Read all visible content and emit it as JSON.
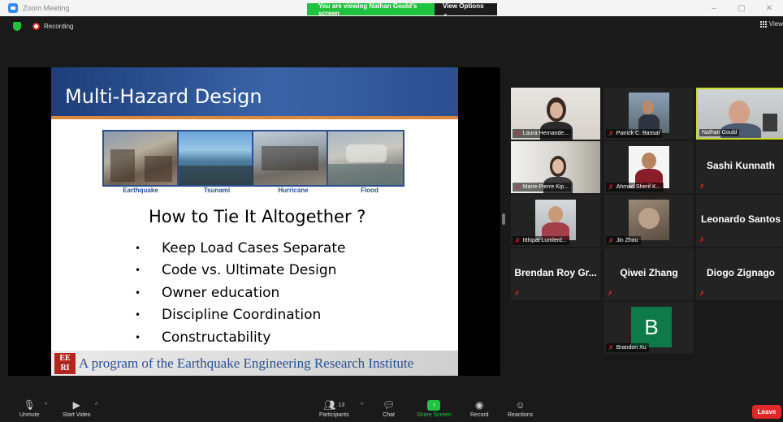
{
  "window": {
    "title": "Zoom Meeting",
    "viewing_banner": "You are viewing Nathan Gould's screen",
    "view_options": "View Options ⌄",
    "controls": [
      "–",
      "▢",
      "✕"
    ]
  },
  "status": {
    "recording_label": "Recording",
    "view_label": "View"
  },
  "slide": {
    "title": "Multi-Hazard Design",
    "photo_labels": [
      "Earthquake",
      "Tsunami",
      "Hurricane",
      "Flood"
    ],
    "subtitle": "How to Tie It Altogether ?",
    "bullets": [
      "Keep Load Cases Separate",
      "Code vs. Ultimate Design",
      "Owner education",
      "Discipline Coordination",
      "Constructability"
    ],
    "logo_lines": [
      "EE",
      "RI"
    ],
    "footer": "A program of the Earthquake Engineering Research Institute"
  },
  "participants": [
    {
      "name": "Laura Hernande...",
      "muted": true,
      "video": true
    },
    {
      "name": "Patrick C. Bassal",
      "muted": true,
      "video": true
    },
    {
      "name": "Nathan Gould",
      "muted": false,
      "video": true,
      "active": true
    },
    {
      "name": "Marie-Pierre Kip...",
      "muted": true,
      "video": true
    },
    {
      "name": "Ahmad Sherif K...",
      "muted": true,
      "video": true
    },
    {
      "name": "Sashi Kunnath",
      "muted": true,
      "video": false
    },
    {
      "name": "Itthipat Lumlerd...",
      "muted": true,
      "video": true
    },
    {
      "name": "Jin Zhou",
      "muted": true,
      "video": true
    },
    {
      "name": "Leonardo Santos",
      "muted": true,
      "video": false
    },
    {
      "name": "Brendan Roy Gr...",
      "muted": true,
      "video": false
    },
    {
      "name": "Qiwei Zhang",
      "muted": true,
      "video": false
    },
    {
      "name": "Diogo Zignago",
      "muted": true,
      "video": false
    },
    {
      "name": "Brandon Xu",
      "muted": true,
      "video": false,
      "avatar_letter": "B"
    }
  ],
  "toolbar": {
    "unmute": "Unmute",
    "start_video": "Start Video",
    "participants": "Participants",
    "participants_count": "13",
    "chat": "Chat",
    "share_screen": "Share Screen",
    "record": "Record",
    "reactions": "Reactions",
    "leave": "Leave"
  },
  "colors": {
    "share_green": "#20c33f",
    "mute_red": "#e02828",
    "active_speaker": "#c8d92a",
    "slide_blue": "#2b4f90"
  }
}
